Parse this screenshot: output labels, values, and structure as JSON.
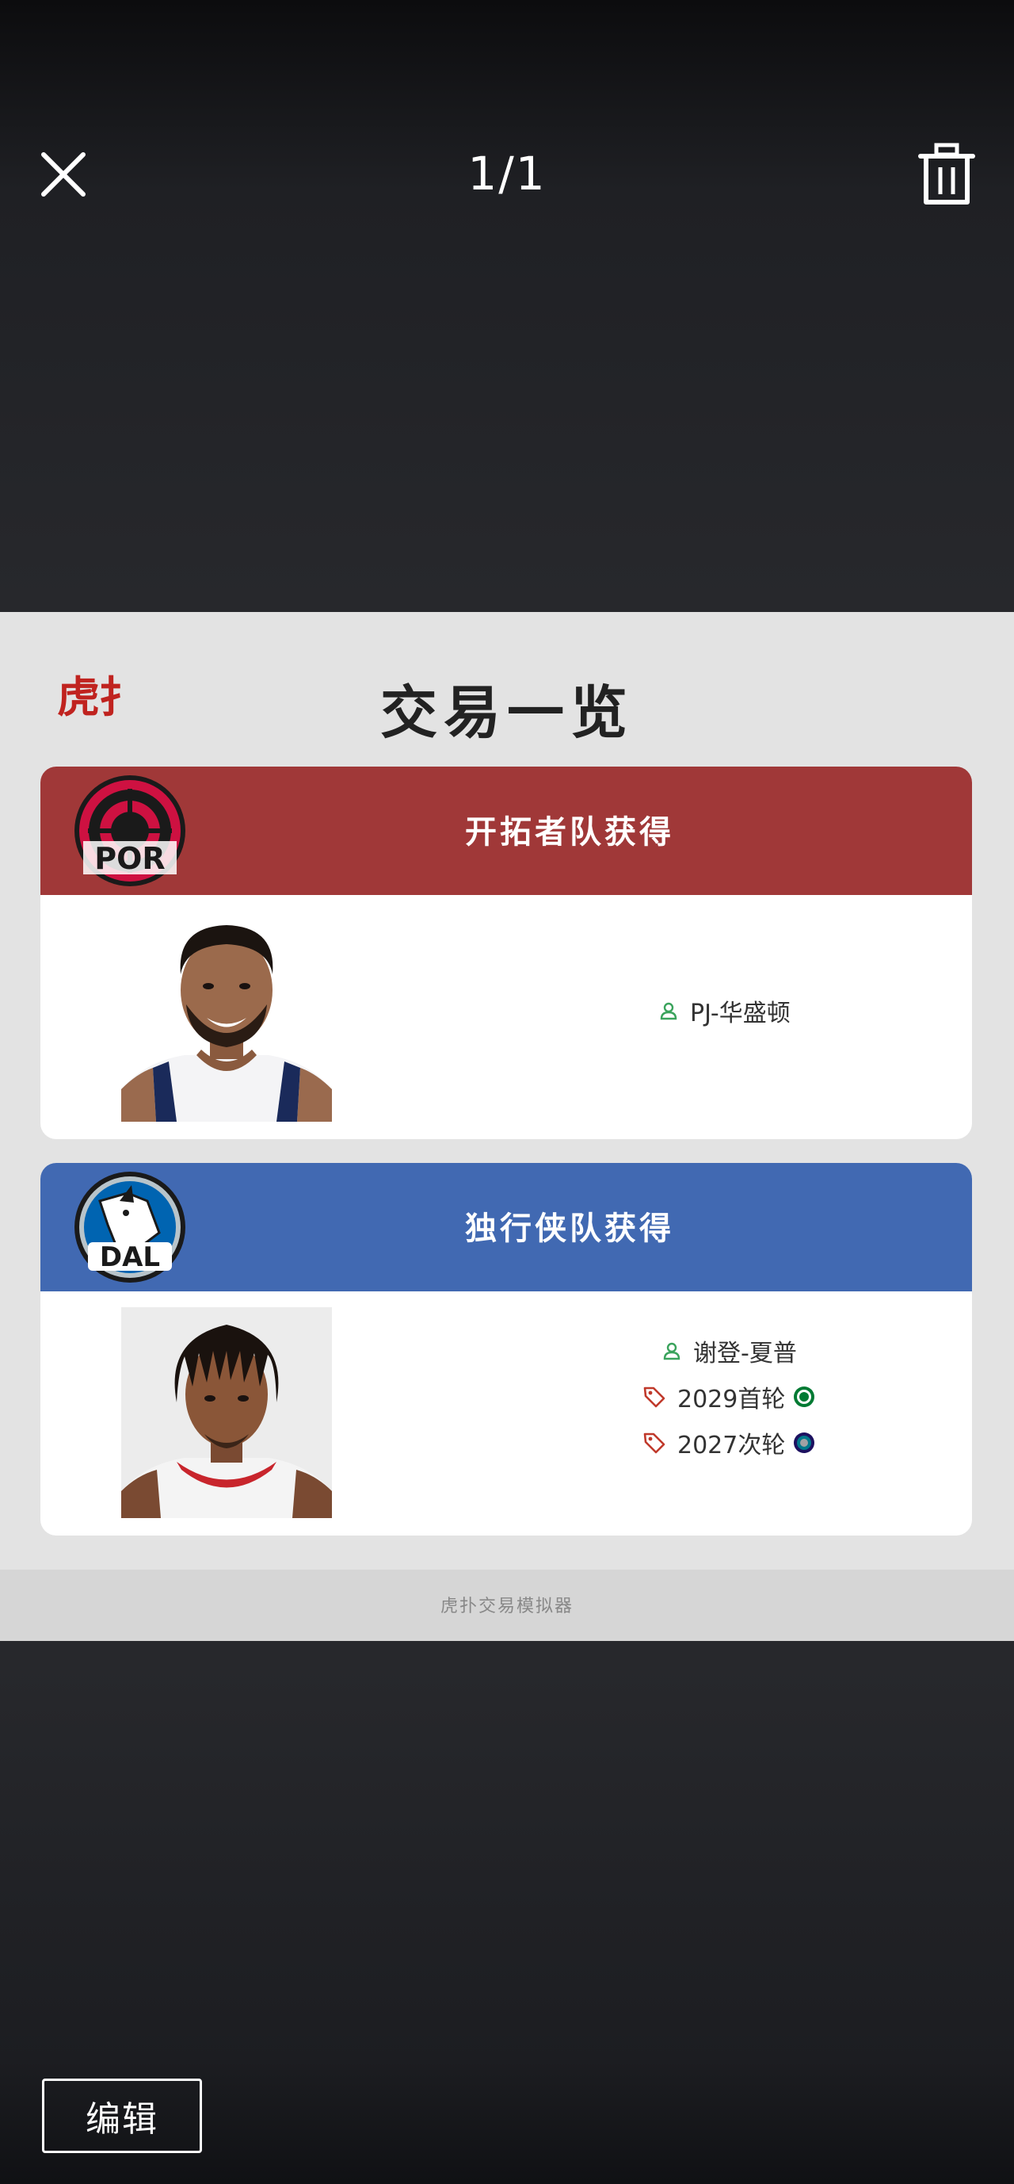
{
  "toolbar": {
    "counter": "1/1",
    "close_icon": "close-icon",
    "delete_icon": "trash-icon"
  },
  "panel": {
    "logo_text": "虎扑",
    "title": "交易一览",
    "footer": "虎扑交易模拟器"
  },
  "cards": [
    {
      "team": "POR",
      "team_color": "#a03838",
      "header": "开拓者队获得",
      "assets": [
        {
          "type": "player",
          "icon": "person-icon",
          "label": "PJ-华盛顿"
        }
      ]
    },
    {
      "team": "DAL",
      "team_color": "#4169b2",
      "header": "独行侠队获得",
      "assets": [
        {
          "type": "player",
          "icon": "person-icon",
          "label": "谢登-夏普"
        },
        {
          "type": "pick",
          "icon": "tag-icon",
          "label": "2029首轮",
          "pick_team": "BOS"
        },
        {
          "type": "pick",
          "icon": "tag-icon",
          "label": "2027次轮",
          "pick_team": "CHA"
        }
      ]
    }
  ],
  "edit_button": "编辑"
}
